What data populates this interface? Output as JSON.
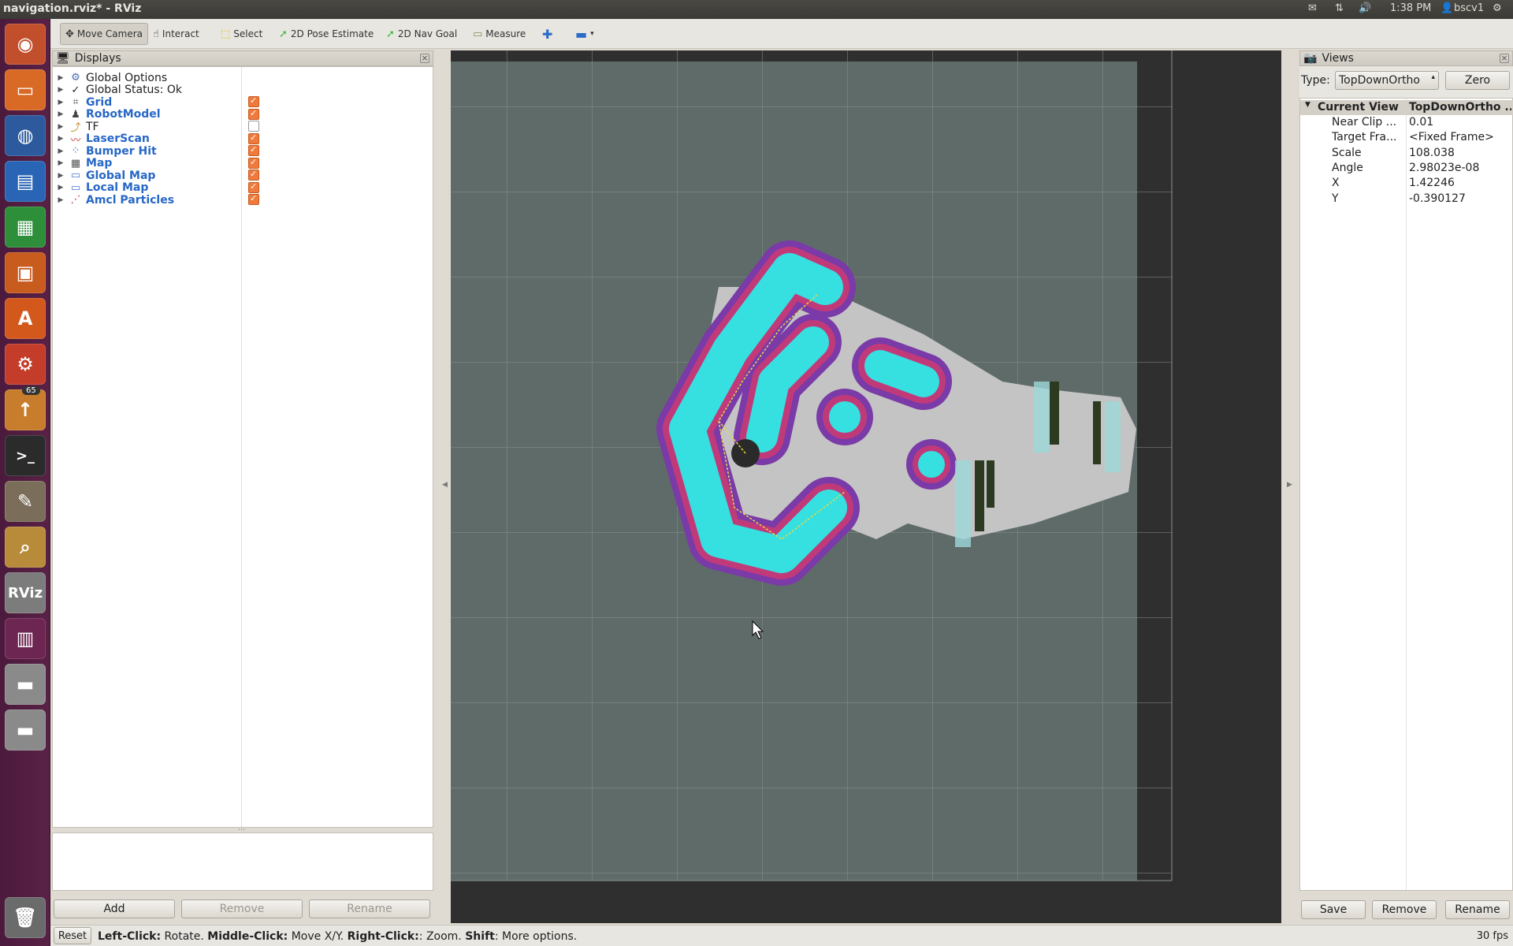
{
  "window_title": "navigation.rviz* - RViz",
  "indicators": {
    "time": "1:38 PM",
    "user": "bscv1"
  },
  "launcher": {
    "badge": "65",
    "rviz_label": "RViz"
  },
  "toolbar": {
    "tools": [
      "Move Camera",
      "Interact",
      "Select",
      "2D Pose Estimate",
      "2D Nav Goal",
      "Measure"
    ]
  },
  "displays": {
    "title": "Displays",
    "items": [
      {
        "label": "Global Options",
        "checked": null,
        "blue": false
      },
      {
        "label": "Global Status: Ok",
        "checked": null,
        "blue": false
      },
      {
        "label": "Grid",
        "checked": true,
        "blue": true
      },
      {
        "label": "RobotModel",
        "checked": true,
        "blue": true
      },
      {
        "label": "TF",
        "checked": false,
        "blue": false
      },
      {
        "label": "LaserScan",
        "checked": true,
        "blue": true
      },
      {
        "label": "Bumper Hit",
        "checked": true,
        "blue": true
      },
      {
        "label": "Map",
        "checked": true,
        "blue": true
      },
      {
        "label": "Global Map",
        "checked": true,
        "blue": true
      },
      {
        "label": "Local Map",
        "checked": true,
        "blue": true
      },
      {
        "label": "Amcl Particles",
        "checked": true,
        "blue": true
      }
    ],
    "buttons": {
      "add": "Add",
      "remove": "Remove",
      "rename": "Rename"
    }
  },
  "views": {
    "title": "Views",
    "type_label": "Type:",
    "type_value": "TopDownOrtho",
    "zero": "Zero",
    "header": {
      "k": "Current View",
      "v": "TopDownOrtho ..."
    },
    "rows": [
      {
        "k": "Near Clip ...",
        "v": "0.01"
      },
      {
        "k": "Target Fra...",
        "v": "<Fixed Frame>"
      },
      {
        "k": "Scale",
        "v": "108.038"
      },
      {
        "k": "Angle",
        "v": "2.98023e-08"
      },
      {
        "k": "X",
        "v": "1.42246"
      },
      {
        "k": "Y",
        "v": "-0.390127"
      }
    ],
    "buttons": {
      "save": "Save",
      "remove": "Remove",
      "rename": "Rename"
    }
  },
  "status": {
    "reset": "Reset",
    "help_bold1": "Left-Click:",
    "help1": " Rotate. ",
    "help_bold2": "Middle-Click:",
    "help2": " Move X/Y. ",
    "help_bold3": "Right-Click:",
    "help3": ": Zoom. ",
    "help_bold4": "Shift",
    "help4": ": More options.",
    "fps": "30 fps"
  }
}
